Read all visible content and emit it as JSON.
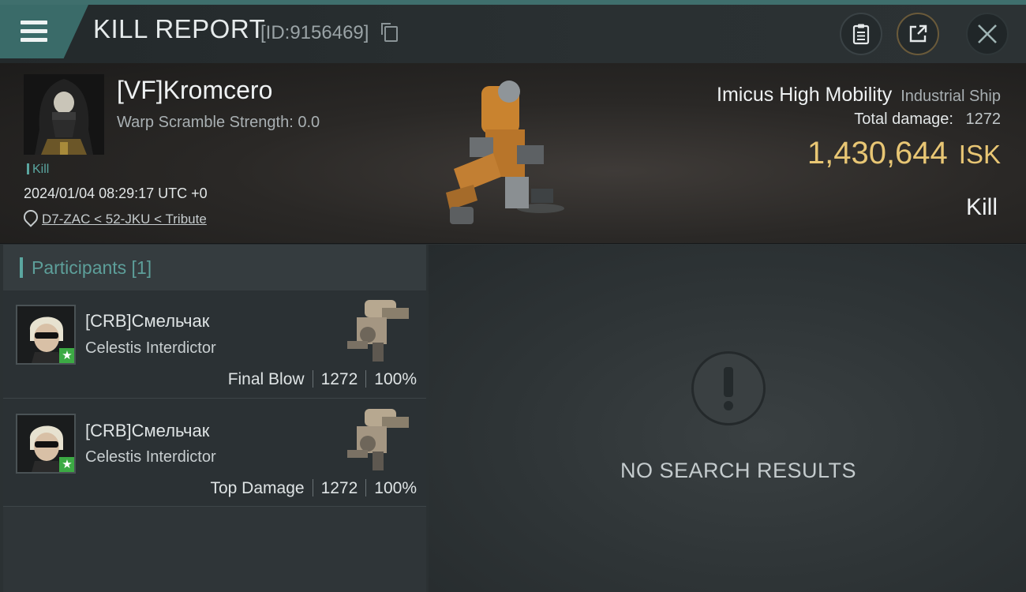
{
  "header": {
    "title": "KILL REPORT",
    "report_id": "[ID:9156469]"
  },
  "victim": {
    "name": "[VF]Kromcero",
    "warp_scramble": "Warp Scramble Strength: 0.0",
    "tag": "Kill",
    "datetime": "2024/01/04 08:29:17 UTC +0",
    "location": "D7-ZAC < 52-JKU < Tribute"
  },
  "ship": {
    "name": "Imicus High Mobility",
    "class": "Industrial Ship",
    "total_damage_label": "Total damage:",
    "total_damage_value": "1272",
    "value": "1,430,644",
    "currency": "ISK",
    "result": "Kill"
  },
  "participants": {
    "label": "Participants [1]",
    "rows": [
      {
        "name": "[CRB]Смельчак",
        "ship": "Celestis Interdictor",
        "role": "Final Blow",
        "damage": "1272",
        "percent": "100%"
      },
      {
        "name": "[CRB]Смельчак",
        "ship": "Celestis Interdictor",
        "role": "Top Damage",
        "damage": "1272",
        "percent": "100%"
      }
    ]
  },
  "empty_state": {
    "text": "NO SEARCH RESULTS"
  },
  "icons": {
    "menu": "menu-icon",
    "copy": "copy-icon",
    "clipboard": "clipboard-icon",
    "share": "share-icon",
    "close": "close-icon",
    "location": "location-pin-icon",
    "star": "star-icon",
    "alert": "alert-icon"
  },
  "colors": {
    "accent": "#5aa6a0",
    "isk": "#e8c674",
    "badge": "#3caa44"
  }
}
